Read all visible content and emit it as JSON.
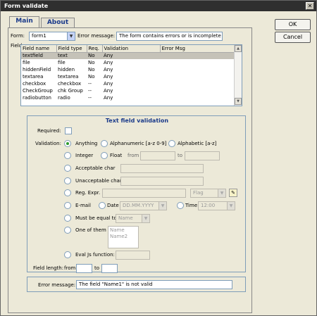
{
  "window": {
    "title": "Form validate"
  },
  "buttons": {
    "ok": "OK",
    "cancel": "Cancel"
  },
  "tabs": [
    "Main",
    "About"
  ],
  "form": {
    "label": "Form:",
    "value": "form1"
  },
  "error_message": {
    "label": "Error message:",
    "value": "The form contains errors or is incomplete"
  },
  "fields": {
    "label": "Fields:",
    "columns": [
      "Field name",
      "Field type",
      "Req.",
      "Validation",
      "Error Msg"
    ],
    "rows": [
      [
        "textfield",
        "text",
        "No",
        "Any",
        ""
      ],
      [
        "file",
        "file",
        "No",
        "Any",
        ""
      ],
      [
        "hiddenField",
        "hidden",
        "No",
        "Any",
        ""
      ],
      [
        "textarea",
        "textarea",
        "No",
        "Any",
        ""
      ],
      [
        "checkbox",
        "checkbox",
        "--",
        "Any",
        ""
      ],
      [
        "CheckGroup",
        "chk Group",
        "--",
        "Any",
        ""
      ],
      [
        "radiobutton",
        "radio",
        "--",
        "Any",
        ""
      ]
    ]
  },
  "validation_group": {
    "title": "Text field validation",
    "required_label": "Required:",
    "validation_label": "Validation:",
    "anything": "Anything",
    "alphanumeric": "Alphanumeric [a-z 0-9]",
    "alphabetic": "Alphabetic [a-z]",
    "integer": "Integer",
    "float": "Float",
    "from": "from",
    "to": "to",
    "acceptable": "Acceptable char",
    "unacceptable": "Unacceptable char",
    "regexpr": "Reg. Expr.",
    "flag": "Flag",
    "email": "E-mail",
    "date": "Date",
    "date_format": "DD.MM.YYYY",
    "time": "Time",
    "time_format": "12:00",
    "equal": "Must be equal to",
    "equal_value": "Name",
    "oneof": "One of them",
    "oneof_items": [
      "Name",
      "Name2"
    ],
    "evaljs": "Eval Js function:",
    "field_length": "Field length:",
    "fl_from": "from",
    "fl_to": "to"
  },
  "error_row": {
    "label": "Error message:",
    "value": "The field \"Name1\" is not valid"
  }
}
